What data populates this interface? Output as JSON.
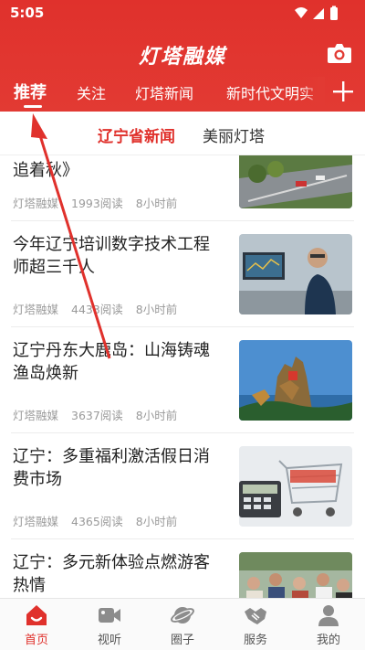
{
  "status_bar": {
    "time": "5:05"
  },
  "app": {
    "title": "灯塔融媒",
    "brand_color": "#e0312c"
  },
  "tabs": [
    {
      "label": "推荐",
      "active": true
    },
    {
      "label": "关注",
      "active": false
    },
    {
      "label": "灯塔新闻",
      "active": false
    },
    {
      "label": "新时代文明实",
      "active": false
    }
  ],
  "subtabs": [
    {
      "label": "辽宁省新闻",
      "active": true
    },
    {
      "label": "美丽灯塔",
      "active": false
    }
  ],
  "feed": [
    {
      "title": "追着秋》",
      "source": "灯塔融媒",
      "reads": "1993阅读",
      "time": "8小时前",
      "thumb": "highway-scene"
    },
    {
      "title": "今年辽宁培训数字技术工程师超三千人",
      "source": "灯塔融媒",
      "reads": "4433阅读",
      "time": "8小时前",
      "thumb": "engineer-at-computer"
    },
    {
      "title": "辽宁丹东大鹿岛：山海铸魂渔岛焕新",
      "source": "灯塔融媒",
      "reads": "3637阅读",
      "time": "8小时前",
      "thumb": "island-deer-rock"
    },
    {
      "title": "辽宁：多重福利激活假日消费市场",
      "source": "灯塔融媒",
      "reads": "4365阅读",
      "time": "8小时前",
      "thumb": "shopping-cart-calculator"
    },
    {
      "title": "辽宁：多元新体验点燃游客热情",
      "source": "",
      "reads": "",
      "time": "",
      "thumb": "tourist-crowd"
    }
  ],
  "bottom_nav": [
    {
      "label": "首页",
      "icon": "home-icon",
      "active": true
    },
    {
      "label": "视听",
      "icon": "video-icon",
      "active": false
    },
    {
      "label": "圈子",
      "icon": "planet-icon",
      "active": false
    },
    {
      "label": "服务",
      "icon": "handshake-icon",
      "active": false
    },
    {
      "label": "我的",
      "icon": "user-icon",
      "active": false
    }
  ]
}
